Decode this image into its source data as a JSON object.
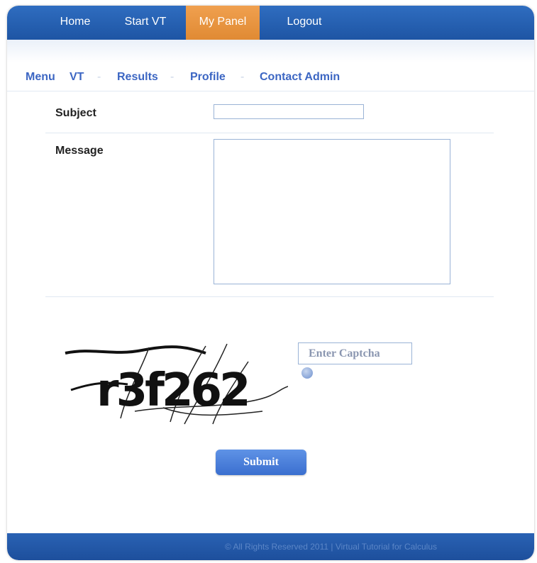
{
  "topnav": {
    "items": [
      {
        "label": "Home",
        "active": false
      },
      {
        "label": "Start VT",
        "active": false
      },
      {
        "label": "My Panel",
        "active": true
      },
      {
        "label": "Logout",
        "active": false
      }
    ],
    "bar_color": "#1e55a4",
    "active_color": "#e08a33"
  },
  "submenu": {
    "items": [
      {
        "label": "Menu"
      },
      {
        "label": "VT"
      },
      {
        "label": "Results"
      },
      {
        "label": "Profile"
      },
      {
        "label": "Contact Admin"
      }
    ],
    "separator": "-",
    "link_color": "#3c66c3"
  },
  "form": {
    "subject_label": "Subject",
    "subject_value": "",
    "message_label": "Message",
    "message_value": "",
    "captcha_text": "r3f262",
    "captcha_placeholder": "Enter Captcha",
    "refresh_icon": "refresh-icon",
    "submit_label": "Submit"
  },
  "footer": {
    "text": "© All Rights Reserved 2011 | Virtual Tutorial for Calculus"
  }
}
